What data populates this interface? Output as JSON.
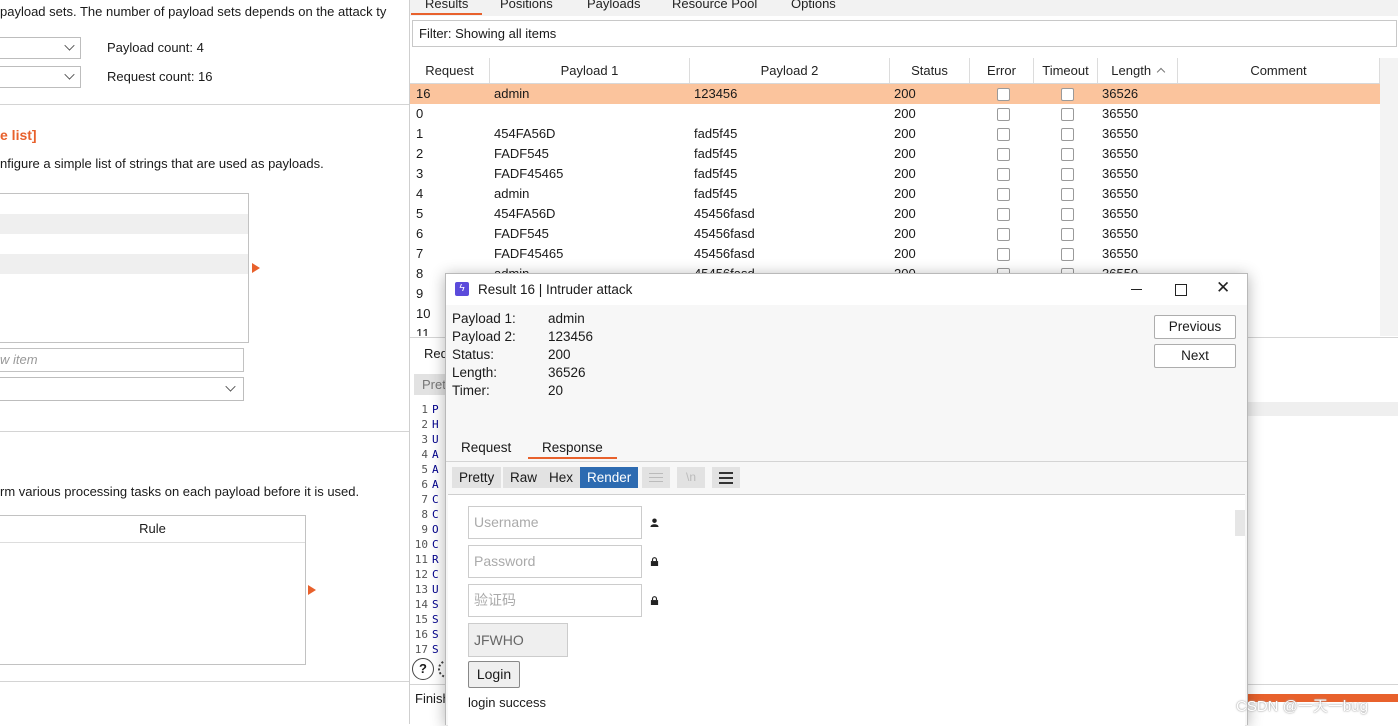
{
  "left": {
    "intro_text": "payload sets. The number of payload sets depends on the attack ty",
    "payload_count": "Payload count: 4",
    "request_count": "Request count: 16",
    "section_title": "e list]",
    "section_desc": "nfigure a simple list of strings that are used as payloads.",
    "add_item_placeholder": "w item",
    "processing_desc": "rm various processing tasks on each payload before it is used.",
    "rule_header": "Rule"
  },
  "results": {
    "tabs": [
      "Results",
      "Positions",
      "Payloads",
      "Resource Pool",
      "Options"
    ],
    "filter": "Filter: Showing all items",
    "columns": [
      "Request",
      "Payload 1",
      "Payload 2",
      "Status",
      "Error",
      "Timeout",
      "Length",
      "Comment"
    ],
    "rows": [
      {
        "request": "16",
        "p1": "admin",
        "p2": "123456",
        "status": "200",
        "length": "36526",
        "selected": true
      },
      {
        "request": "0",
        "p1": "",
        "p2": "",
        "status": "200",
        "length": "36550"
      },
      {
        "request": "1",
        "p1": "454FA56D",
        "p2": "fad5f45",
        "status": "200",
        "length": "36550"
      },
      {
        "request": "2",
        "p1": "FADF545",
        "p2": "fad5f45",
        "status": "200",
        "length": "36550"
      },
      {
        "request": "3",
        "p1": "FADF45465",
        "p2": "fad5f45",
        "status": "200",
        "length": "36550"
      },
      {
        "request": "4",
        "p1": "admin",
        "p2": "fad5f45",
        "status": "200",
        "length": "36550"
      },
      {
        "request": "5",
        "p1": "454FA56D",
        "p2": "45456fasd",
        "status": "200",
        "length": "36550"
      },
      {
        "request": "6",
        "p1": "FADF545",
        "p2": "45456fasd",
        "status": "200",
        "length": "36550"
      },
      {
        "request": "7",
        "p1": "FADF45465",
        "p2": "45456fasd",
        "status": "200",
        "length": "36550"
      },
      {
        "request": "8",
        "p1": "admin",
        "p2": "45456fasd",
        "status": "200",
        "length": "36550"
      },
      {
        "request": "9",
        "p1": "",
        "p2": "",
        "status": "",
        "length": ""
      },
      {
        "request": "10",
        "p1": "",
        "p2": "",
        "status": "",
        "length": ""
      },
      {
        "request": "11",
        "p1": "",
        "p2": "",
        "status": "",
        "length": ""
      }
    ],
    "bottom_tab": "Req",
    "pretty_stub": "Pret",
    "editor_lines": [
      "P",
      "H",
      "U",
      "A",
      "A",
      "A",
      "C",
      "C",
      "O",
      "C",
      "R",
      "C",
      "U",
      "S",
      "S",
      "S",
      "S"
    ],
    "status_stub": "Finish"
  },
  "dialog": {
    "title": "Result 16 | Intruder attack",
    "fields": [
      {
        "k": "Payload 1:",
        "v": "admin"
      },
      {
        "k": "Payload 2:",
        "v": "123456"
      },
      {
        "k": "Status:",
        "v": "200"
      },
      {
        "k": "Length:",
        "v": "36526"
      },
      {
        "k": "Timer:",
        "v": "20"
      }
    ],
    "previous": "Previous",
    "next": "Next",
    "tab_request": "Request",
    "tab_response": "Response",
    "modes": [
      "Pretty",
      "Raw",
      "Hex",
      "Render"
    ],
    "render": {
      "username_placeholder": "Username",
      "password_placeholder": "Password",
      "captcha_placeholder": "验证码",
      "captcha_code": "JFWHO",
      "login_button": "Login",
      "message": "login success"
    }
  },
  "watermark": "CSDN @一天一bug",
  "colors": {
    "accent": "#e8612c",
    "selected_row": "#fbc49d",
    "render_active": "#2d6bb1"
  }
}
